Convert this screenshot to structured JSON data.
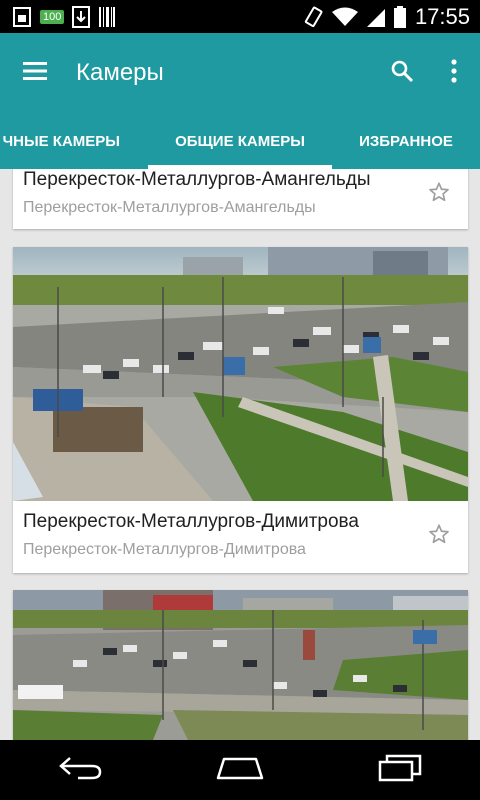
{
  "status_bar": {
    "time": "17:55",
    "badge": "100",
    "icons": [
      "sim-icon",
      "battery-100-icon",
      "download-icon",
      "barcode-icon",
      "vibrate-icon",
      "wifi-icon",
      "signal-icon",
      "battery-icon"
    ]
  },
  "app_bar": {
    "title": "Камеры",
    "menu_icon": "menu-icon",
    "search_icon": "search-icon",
    "overflow_icon": "more-vert-icon",
    "color": "#1e9aa0"
  },
  "tabs": [
    {
      "label": "ЛИЧНЫЕ КАМЕРЫ",
      "visible_label": "ЧНЫЕ КАМЕРЫ",
      "active": false
    },
    {
      "label": "ОБЩИЕ КАМЕРЫ",
      "active": true
    },
    {
      "label": "ИЗБРАННОЕ",
      "active": false
    }
  ],
  "cameras": [
    {
      "title": "Перекресток-Металлургов-Амангельды",
      "subtitle": "Перекресток-Металлургов-Амангельды",
      "favorite": false
    },
    {
      "title": "Перекресток-Металлургов-Димитрова",
      "subtitle": "Перекресток-Металлургов-Димитрова",
      "favorite": false
    },
    {
      "title": "",
      "subtitle": "",
      "favorite": false
    }
  ],
  "nav_bar": {
    "back_icon": "back-icon",
    "home_icon": "home-icon",
    "recents_icon": "recents-icon"
  }
}
